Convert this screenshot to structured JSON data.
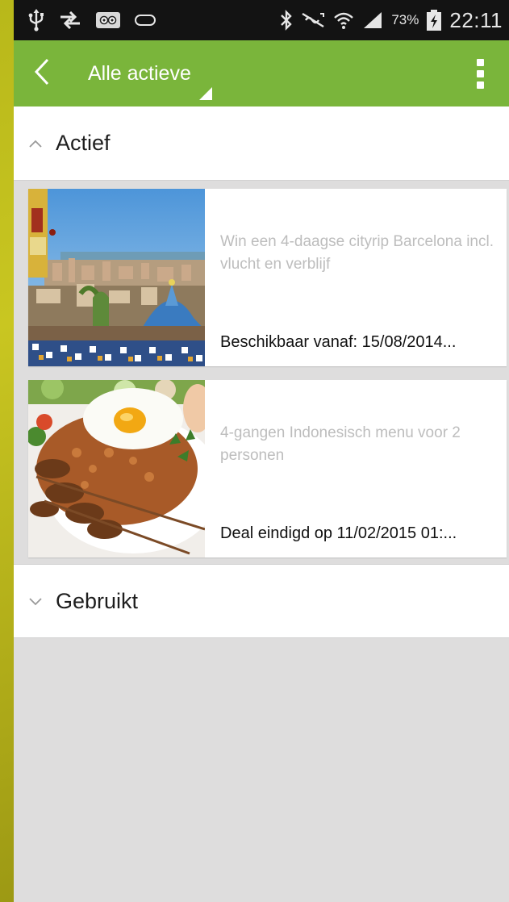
{
  "status_bar": {
    "icons": [
      "usb-icon",
      "sync-icon",
      "tripadvisor-icon",
      "voicemail-icon",
      "bluetooth-icon",
      "nfc-mute-icon",
      "wifi-icon",
      "signal-icon",
      "battery-charging-icon"
    ],
    "battery": "73%",
    "time": "22:11"
  },
  "app_bar": {
    "title": "Alle actieve",
    "background_color": "#7ab53b"
  },
  "sections": {
    "active": {
      "title": "Actief",
      "expanded": true,
      "deals": [
        {
          "description": "Win een 4-daagse cityrip Barcelona incl. vlucht en verblijf",
          "status": "Beschikbaar vanaf: 15/08/2014...",
          "image": "barcelona-park-guell"
        },
        {
          "description": "4-gangen Indonesisch menu voor 2 personen",
          "status": "Deal eindigd op 11/02/2015 01:...",
          "image": "nasi-goreng-sate"
        }
      ]
    },
    "used": {
      "title": "Gebruikt",
      "expanded": false
    }
  }
}
